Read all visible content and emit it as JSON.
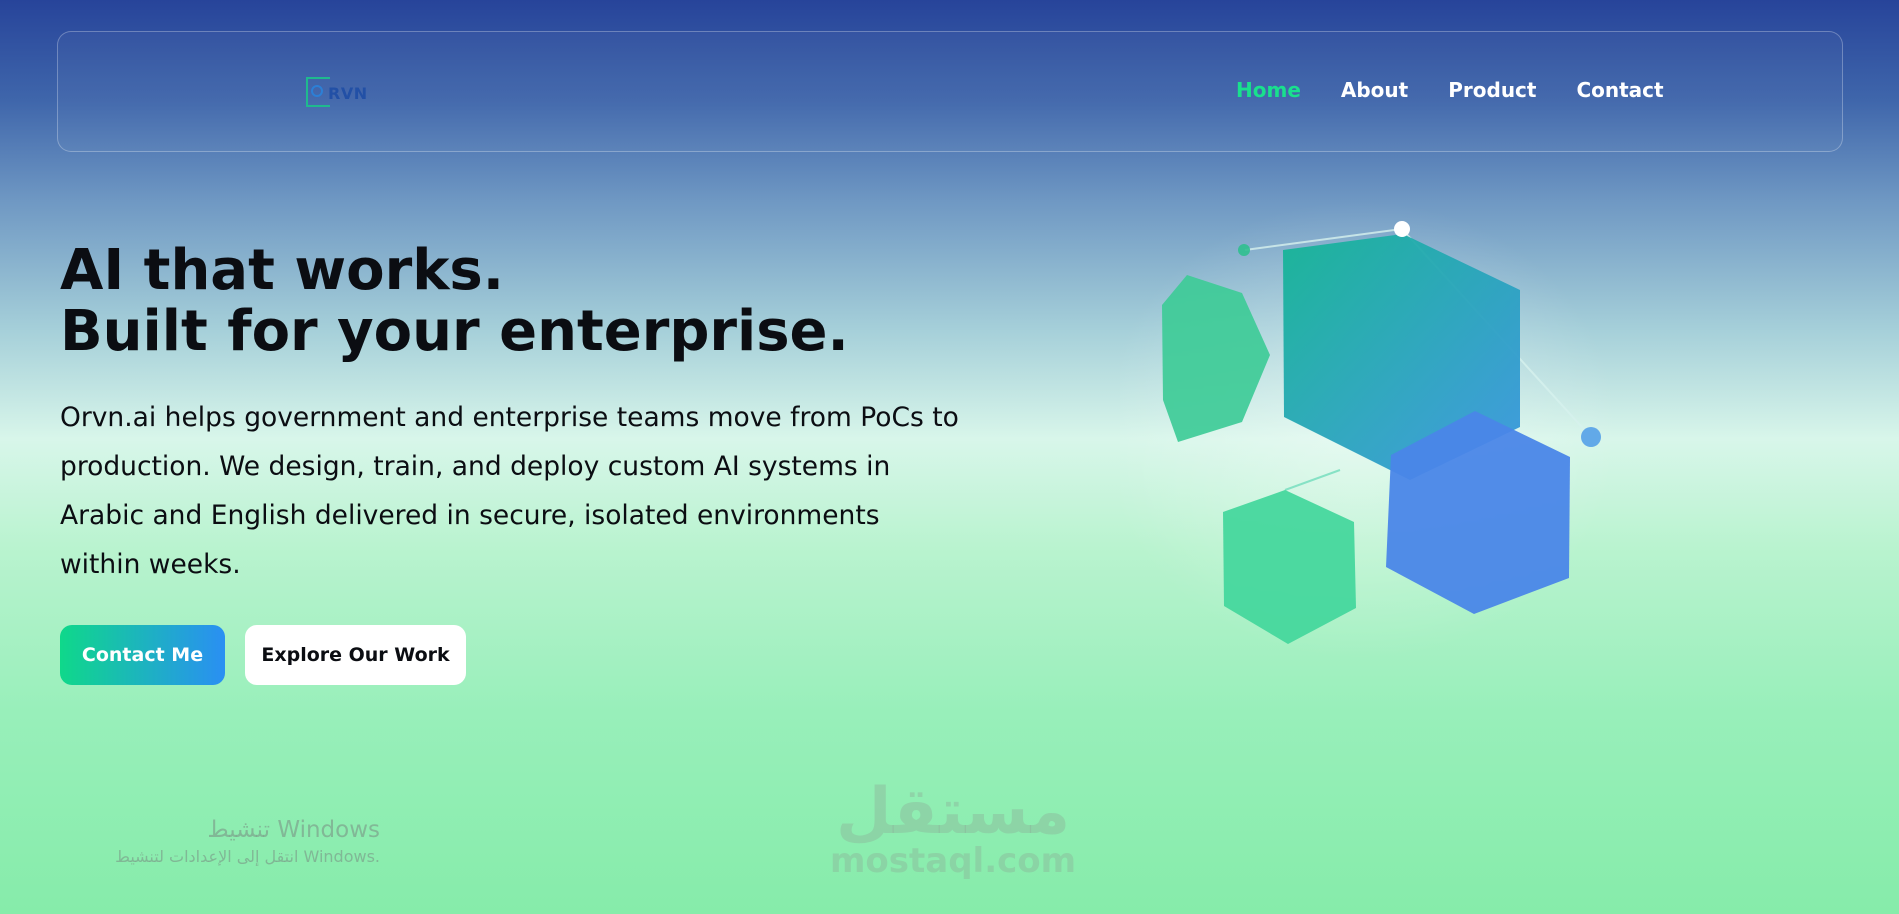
{
  "brand": {
    "logo_text": "RVN"
  },
  "nav": {
    "items": [
      {
        "label": "Home",
        "active": true
      },
      {
        "label": "About",
        "active": false
      },
      {
        "label": "Product",
        "active": false
      },
      {
        "label": "Contact",
        "active": false
      }
    ]
  },
  "hero": {
    "title_line1": "AI that works.",
    "title_line2": "Built for your enterprise.",
    "description": "Orvn.ai helps government and enterprise teams move from PoCs to production. We design, train, and deploy custom AI systems in Arabic and English delivered in secure, isolated environments within weeks.",
    "primary_cta": "Contact Me",
    "secondary_cta": "Explore Our Work"
  },
  "overlays": {
    "watermark_ar": "مستقل",
    "watermark_lat": "mostaql.com",
    "activation_title": "تنشيط Windows",
    "activation_subtitle": "انتقل إلى الإعدادات لتنشيط Windows."
  },
  "colors": {
    "nav_active": "#19e08d",
    "nav_text": "#ffffff",
    "cta_gradient_start": "#0fd88a",
    "cta_gradient_end": "#2a8ff3",
    "hex_green": "#3ecb97",
    "hex_teal": "#1fb0a0",
    "hex_blue": "#4a86e8"
  }
}
